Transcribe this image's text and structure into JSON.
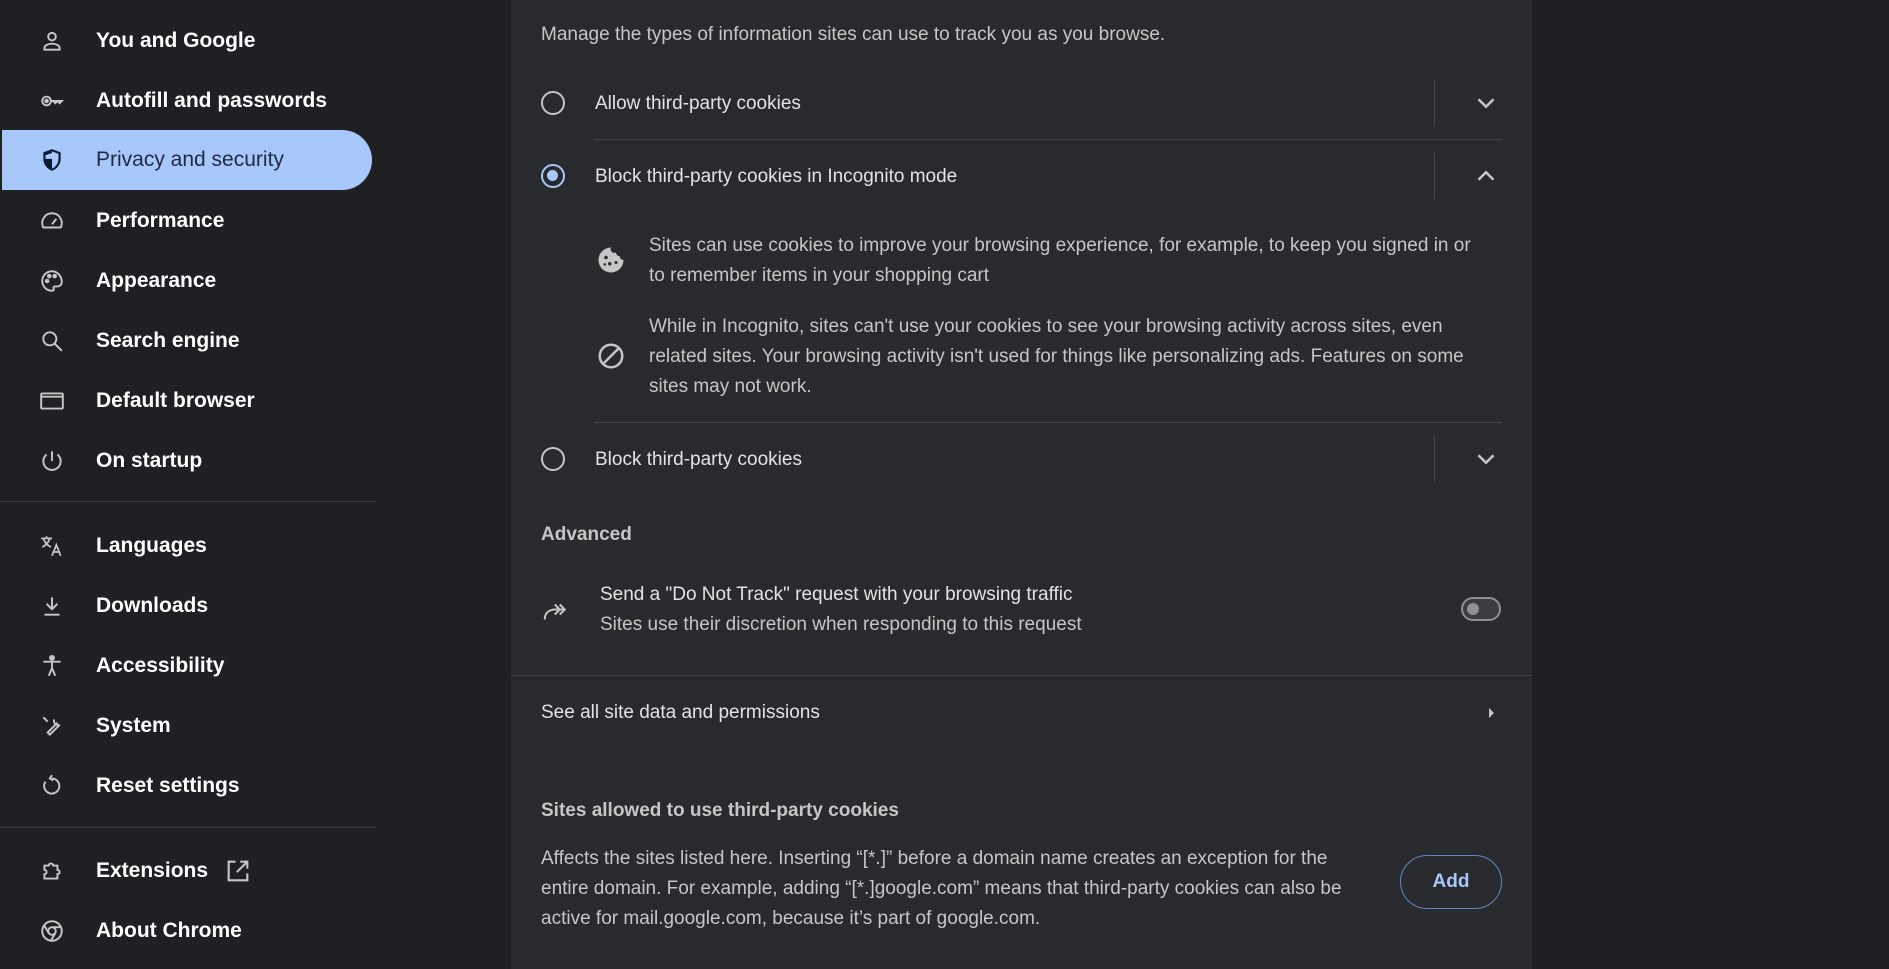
{
  "sidebar": {
    "items": [
      {
        "label": "You and Google",
        "icon": "person-icon"
      },
      {
        "label": "Autofill and passwords",
        "icon": "key-icon"
      },
      {
        "label": "Privacy and security",
        "icon": "shield-icon",
        "active": true
      },
      {
        "label": "Performance",
        "icon": "speedometer-icon"
      },
      {
        "label": "Appearance",
        "icon": "palette-icon"
      },
      {
        "label": "Search engine",
        "icon": "search-icon"
      },
      {
        "label": "Default browser",
        "icon": "browser-window-icon"
      },
      {
        "label": "On startup",
        "icon": "power-icon"
      },
      {
        "label": "Languages",
        "icon": "translate-icon"
      },
      {
        "label": "Downloads",
        "icon": "download-icon"
      },
      {
        "label": "Accessibility",
        "icon": "accessibility-icon"
      },
      {
        "label": "System",
        "icon": "wrench-icon"
      },
      {
        "label": "Reset settings",
        "icon": "reset-icon"
      },
      {
        "label": "Extensions",
        "icon": "puzzle-icon"
      },
      {
        "label": "About Chrome",
        "icon": "chrome-icon"
      }
    ]
  },
  "cookies": {
    "intro": "Manage the types of information sites can use to track you as you browse.",
    "options": [
      {
        "label": "Allow third-party cookies",
        "selected": false,
        "expanded": false
      },
      {
        "label": "Block third-party cookies in Incognito mode",
        "selected": true,
        "expanded": true
      },
      {
        "label": "Block third-party cookies",
        "selected": false,
        "expanded": false
      }
    ],
    "details": {
      "line1a": "Sites can use cookies to improve your browsing experience, for example, to keep you signed in or",
      "line1b": "to remember items in your shopping cart",
      "line2a": "While in Incognito, sites can't use your cookies to see your browsing activity across sites, even",
      "line2b": "related sites. Your browsing activity isn't used for things like personalizing ads. Features on some",
      "line2c": "sites may not work."
    }
  },
  "advanced": {
    "heading": "Advanced",
    "dnt_title": "Send a \"Do Not Track\" request with your browsing traffic",
    "dnt_subtitle": "Sites use their discretion when responding to this request",
    "dnt_enabled": false
  },
  "site_data_link": "See all site data and permissions",
  "allowed": {
    "heading": "Sites allowed to use third-party cookies",
    "desc_a": "Affects the sites listed here. Inserting “[*.]” before a domain name creates an exception for the",
    "desc_b": "entire domain. For example, adding “[*.]google.com” means that third-party cookies can also be",
    "desc_c": "active for mail.google.com, because it’s part of google.com.",
    "add_label": "Add"
  },
  "colors": {
    "accent": "#a8c7fa",
    "surface": "#292a2d",
    "background": "#1f2023"
  }
}
